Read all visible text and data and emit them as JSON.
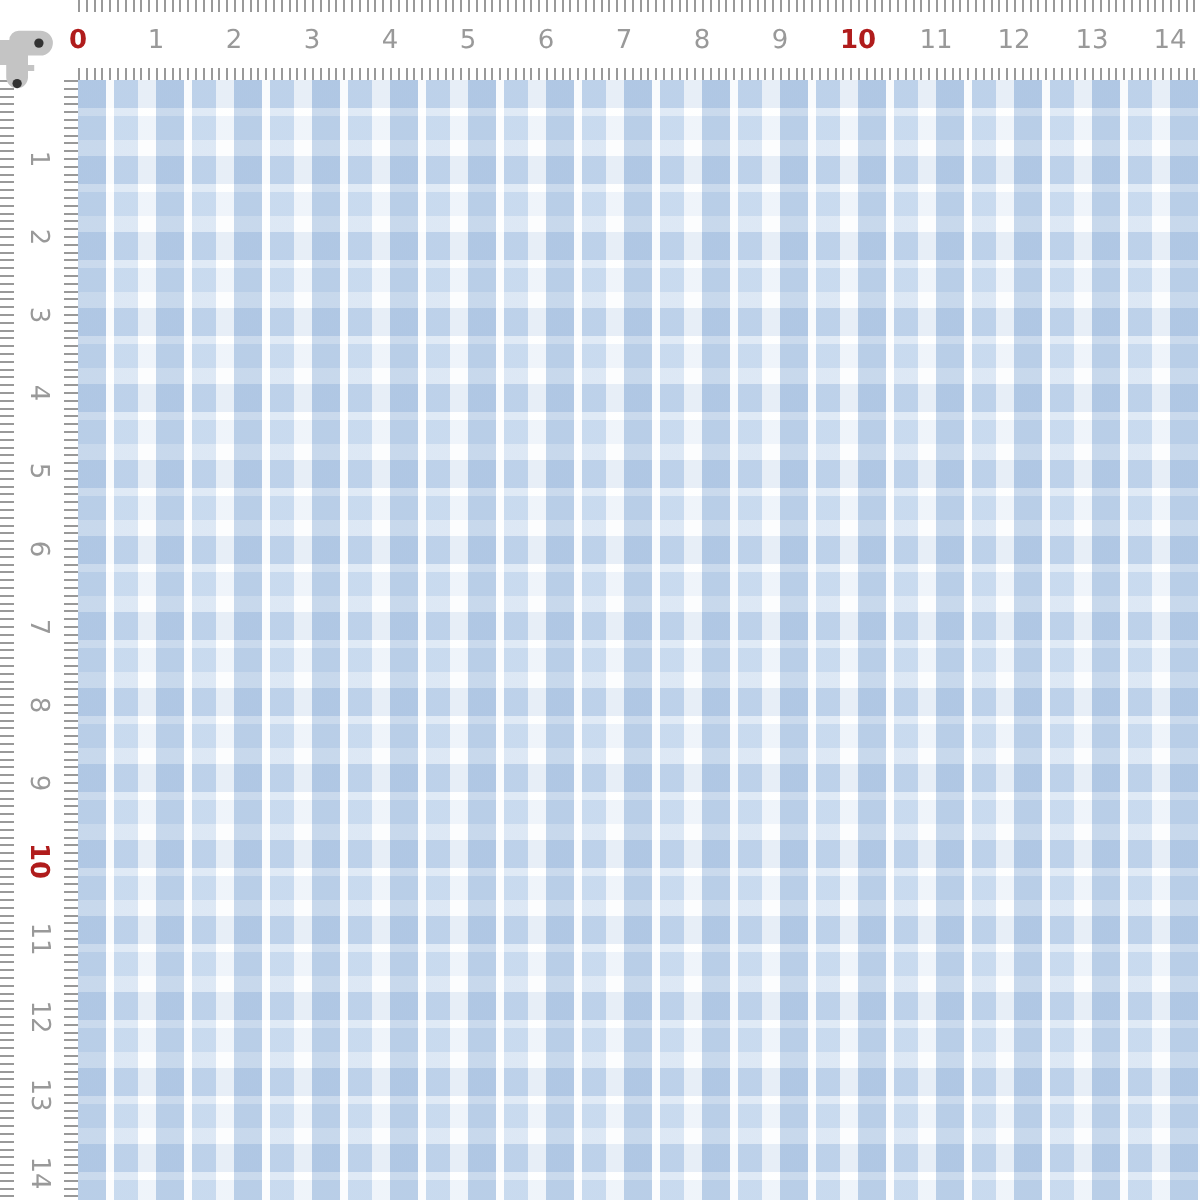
{
  "top_ruler": {
    "labels": [
      {
        "text": "0",
        "highlighted": true
      },
      {
        "text": "1",
        "highlighted": false
      },
      {
        "text": "2",
        "highlighted": false
      },
      {
        "text": "3",
        "highlighted": false
      },
      {
        "text": "4",
        "highlighted": false
      },
      {
        "text": "5",
        "highlighted": false
      },
      {
        "text": "6",
        "highlighted": false
      },
      {
        "text": "7",
        "highlighted": false
      },
      {
        "text": "8",
        "highlighted": false
      },
      {
        "text": "9",
        "highlighted": false
      },
      {
        "text": "10",
        "highlighted": true
      },
      {
        "text": "11",
        "highlighted": false
      },
      {
        "text": "12",
        "highlighted": false
      },
      {
        "text": "13",
        "highlighted": false
      },
      {
        "text": "14",
        "highlighted": false
      }
    ]
  },
  "left_ruler": {
    "labels": [
      {
        "text": "1",
        "highlighted": false
      },
      {
        "text": "2",
        "highlighted": false
      },
      {
        "text": "3",
        "highlighted": false
      },
      {
        "text": "4",
        "highlighted": false
      },
      {
        "text": "5",
        "highlighted": false
      },
      {
        "text": "6",
        "highlighted": false
      },
      {
        "text": "7",
        "highlighted": false
      },
      {
        "text": "8",
        "highlighted": false
      },
      {
        "text": "9",
        "highlighted": false
      },
      {
        "text": "10",
        "highlighted": true
      },
      {
        "text": "11",
        "highlighted": false
      },
      {
        "text": "12",
        "highlighted": false
      },
      {
        "text": "13",
        "highlighted": false
      },
      {
        "text": "14",
        "highlighted": false
      }
    ]
  }
}
